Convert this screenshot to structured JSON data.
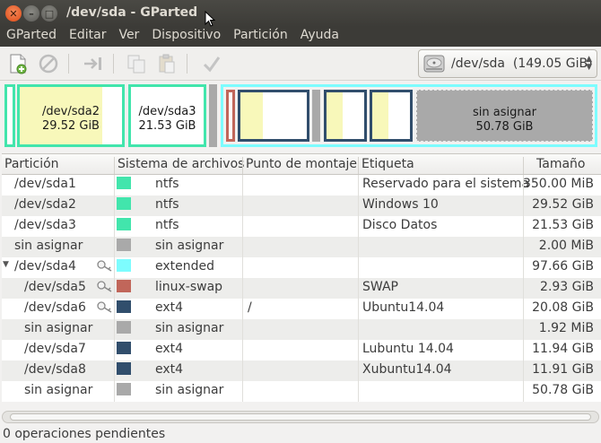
{
  "window": {
    "title": "/dev/sda - GParted"
  },
  "menu": [
    "GParted",
    "Editar",
    "Ver",
    "Dispositivo",
    "Partición",
    "Ayuda"
  ],
  "toolbar": {
    "buttons": [
      {
        "icon": "new-partition-icon",
        "enabled": true
      },
      {
        "icon": "delete-icon",
        "enabled": false
      },
      {
        "icon": "resize-move-icon",
        "enabled": false
      },
      {
        "icon": "copy-icon",
        "enabled": false
      },
      {
        "icon": "paste-icon",
        "enabled": false
      },
      {
        "icon": "apply-check-icon",
        "enabled": false
      }
    ],
    "device_selector": {
      "device": "/dev/sda",
      "size": "(149.05 GiB)"
    }
  },
  "graph": {
    "sda2": {
      "name": "/dev/sda2",
      "size": "29.52 GiB"
    },
    "sda3": {
      "name": "/dev/sda3",
      "size": "21.53 GiB"
    },
    "unallocated": {
      "name": "sin asignar",
      "size": "50.78 GiB"
    }
  },
  "table": {
    "columns": [
      "Partición",
      "Sistema de archivos",
      "Punto de montaje",
      "Etiqueta",
      "Tamaño"
    ],
    "rows": [
      {
        "partition": "/dev/sda1",
        "fs": "ntfs",
        "color": "#42e5ac",
        "mount": "",
        "label": "Reservado para el sistema",
        "size": "350.00 MiB",
        "indent": 1,
        "key": false,
        "expander": false
      },
      {
        "partition": "/dev/sda2",
        "fs": "ntfs",
        "color": "#42e5ac",
        "mount": "",
        "label": "Windows 10",
        "size": "29.52 GiB",
        "indent": 1,
        "key": false,
        "expander": false
      },
      {
        "partition": "/dev/sda3",
        "fs": "ntfs",
        "color": "#42e5ac",
        "mount": "",
        "label": "Disco Datos",
        "size": "21.53 GiB",
        "indent": 1,
        "key": false,
        "expander": false
      },
      {
        "partition": "sin asignar",
        "fs": "sin asignar",
        "color": "#a9a9a9",
        "mount": "",
        "label": "",
        "size": "2.00 MiB",
        "indent": 1,
        "key": false,
        "expander": false
      },
      {
        "partition": "/dev/sda4",
        "fs": "extended",
        "color": "#7dfcfe",
        "mount": "",
        "label": "",
        "size": "97.66 GiB",
        "indent": 1,
        "key": true,
        "expander": true
      },
      {
        "partition": "/dev/sda5",
        "fs": "linux-swap",
        "color": "#c1665a",
        "mount": "",
        "label": "SWAP",
        "size": "2.93 GiB",
        "indent": 2,
        "key": true,
        "expander": false
      },
      {
        "partition": "/dev/sda6",
        "fs": "ext4",
        "color": "#314e6c",
        "mount": "/",
        "label": "Ubuntu14.04",
        "size": "20.08 GiB",
        "indent": 2,
        "key": true,
        "expander": false
      },
      {
        "partition": "sin asignar",
        "fs": "sin asignar",
        "color": "#a9a9a9",
        "mount": "",
        "label": "",
        "size": "1.92 MiB",
        "indent": 2,
        "key": false,
        "expander": false
      },
      {
        "partition": "/dev/sda7",
        "fs": "ext4",
        "color": "#314e6c",
        "mount": "",
        "label": "Lubuntu 14.04",
        "size": "11.94 GiB",
        "indent": 2,
        "key": false,
        "expander": false
      },
      {
        "partition": "/dev/sda8",
        "fs": "ext4",
        "color": "#314e6c",
        "mount": "",
        "label": "Xubuntu14.04",
        "size": "11.91 GiB",
        "indent": 2,
        "key": false,
        "expander": false
      },
      {
        "partition": "sin asignar",
        "fs": "sin asignar",
        "color": "#a9a9a9",
        "mount": "",
        "label": "",
        "size": "50.78 GiB",
        "indent": 2,
        "key": false,
        "expander": false
      }
    ]
  },
  "status": {
    "text": "0 operaciones pendientes"
  },
  "colors": {
    "ntfs": "#42e5ac",
    "extended": "#7dfcfe",
    "swap": "#c1665a",
    "ext4": "#314e6c",
    "unallocated": "#a9a9a9",
    "used": "#f8f8ba"
  }
}
